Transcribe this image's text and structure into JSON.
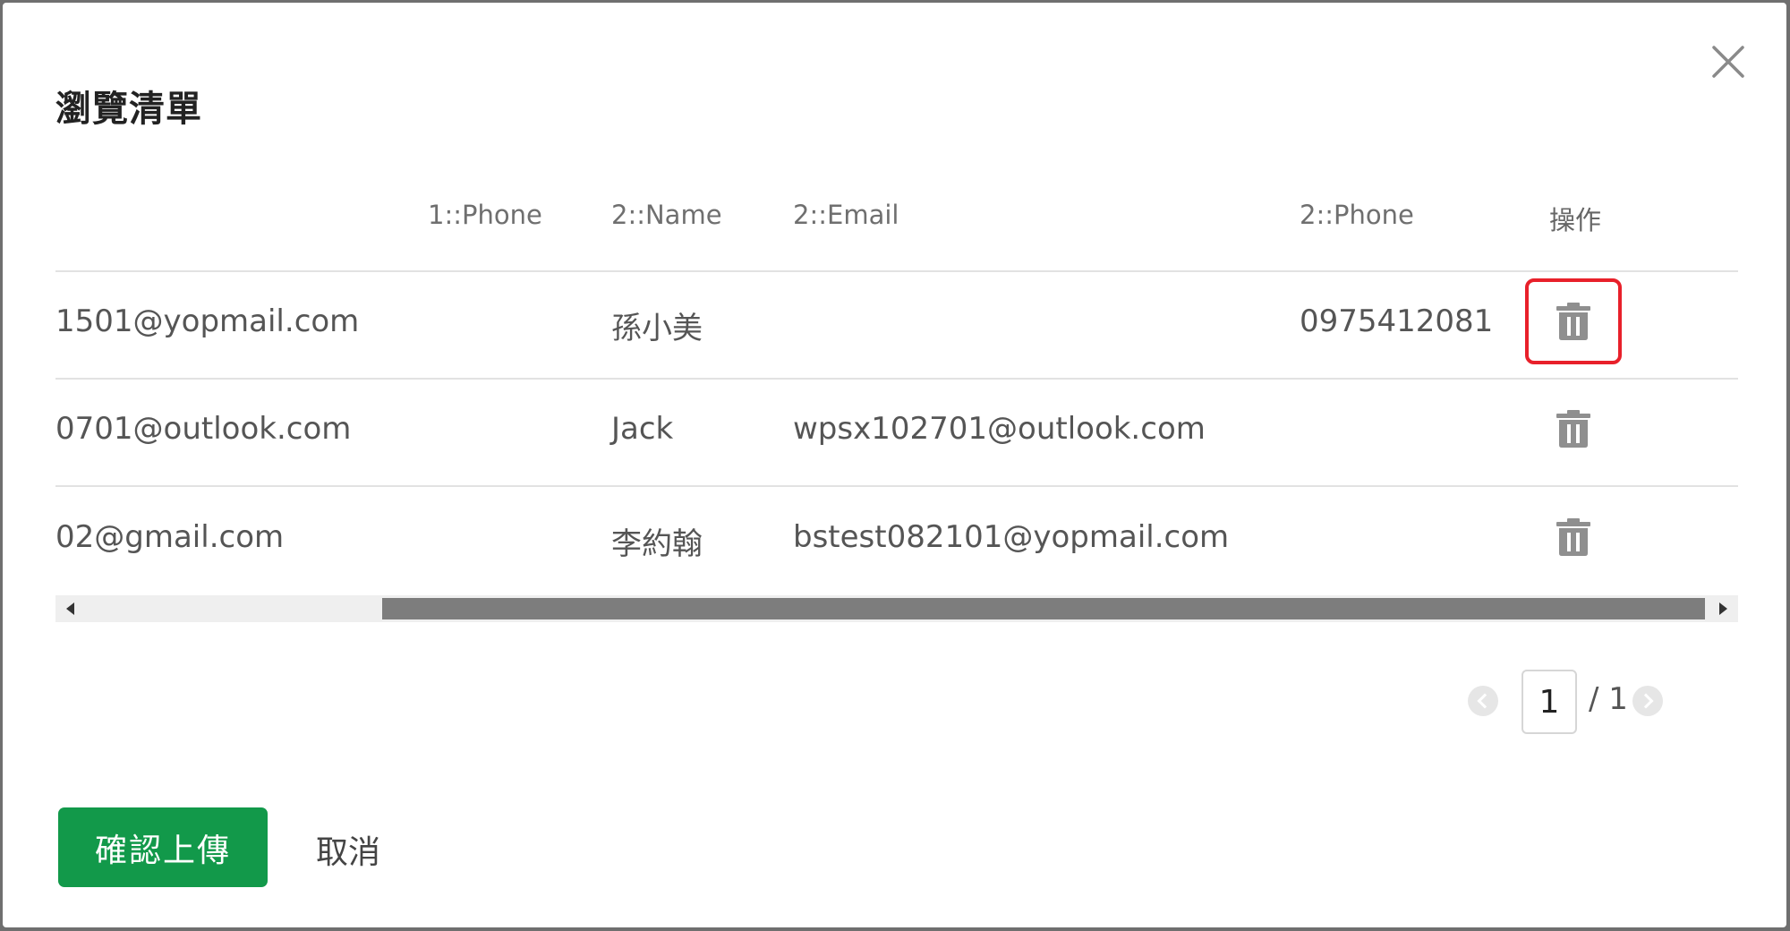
{
  "dialog": {
    "title": "瀏覽清單",
    "close_icon": "close-icon"
  },
  "table": {
    "columns": [
      "1::Phone",
      "2::Name",
      "2::Email",
      "2::Phone",
      "操作"
    ],
    "rows": [
      {
        "partial_email": "1501@yopmail.com",
        "phone1": "",
        "name": "孫小美",
        "email": "",
        "phone2": "0975412081",
        "action_icon": "trash-icon"
      },
      {
        "partial_email": "0701@outlook.com",
        "phone1": "",
        "name": "Jack",
        "email": "wpsx102701@outlook.com",
        "phone2": "",
        "action_icon": "trash-icon"
      },
      {
        "partial_email": "02@gmail.com",
        "phone1": "",
        "name": "李約翰",
        "email": "bstest082101@yopmail.com",
        "phone2": "",
        "action_icon": "trash-icon"
      }
    ],
    "highlight_color": "#e8202a"
  },
  "pagination": {
    "current_page": "1",
    "total": "/ 1"
  },
  "footer": {
    "confirm_label": "確認上傳",
    "cancel_label": "取消",
    "confirm_color": "#12994a"
  }
}
